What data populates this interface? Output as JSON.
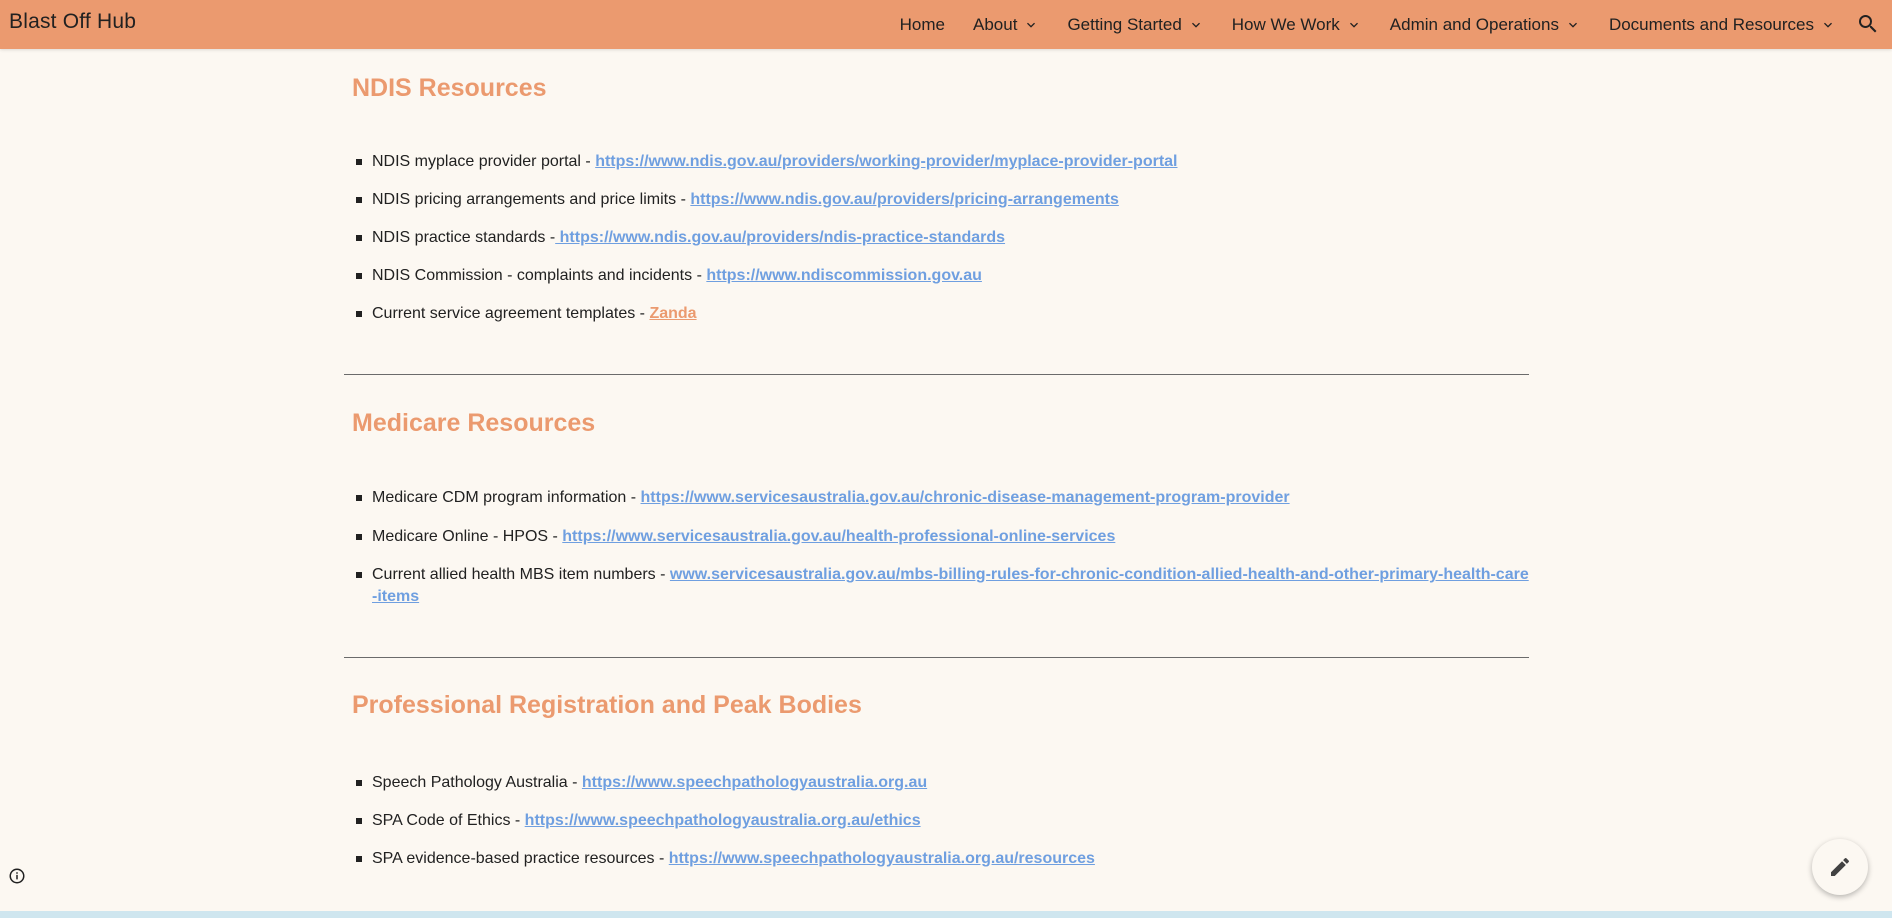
{
  "header": {
    "site_title": "Blast Off Hub",
    "nav": [
      {
        "label": "Home",
        "dropdown": false
      },
      {
        "label": "About",
        "dropdown": true
      },
      {
        "label": "Getting Started",
        "dropdown": true
      },
      {
        "label": "How We Work",
        "dropdown": true
      },
      {
        "label": "Admin and Operations",
        "dropdown": true
      },
      {
        "label": "Documents and Resources",
        "dropdown": true
      }
    ],
    "search_icon": "search-icon"
  },
  "sections": [
    {
      "title": "NDIS Resources",
      "items": [
        {
          "text": "NDIS myplace provider portal - ",
          "link": "https://www.ndis.gov.au/providers/working-provider/myplace-provider-portal"
        },
        {
          "text": "NDIS pricing arrangements and price limits - ",
          "link": "https://www.ndis.gov.au/providers/pricing-arrangements"
        },
        {
          "text": "NDIS practice standards -",
          "link": " https://www.ndis.gov.au/providers/ndis-practice-standards"
        },
        {
          "text": "NDIS Commission - complaints and incidents - ",
          "link": "https://www.ndiscommission.gov.au"
        },
        {
          "text": "Current service agreement templates - ",
          "link": "Zanda "
        }
      ]
    },
    {
      "title": "Medicare Resources",
      "items": [
        {
          "text": "Medicare CDM program information - ",
          "link": "https://www.servicesaustralia.gov.au/chronic-disease-management-program-provider"
        },
        {
          "text": "Medicare Online - HPOS - ",
          "link": "https://www.servicesaustralia.gov.au/health-professional-online-services"
        },
        {
          "text": "Current allied health MBS item numbers - ",
          "link": "www.servicesaustralia.gov.au/mbs-billing-rules-for-chronic-condition-allied-health-and-other-primary-health-care-items"
        }
      ]
    },
    {
      "title": "Professional Registration and Peak Bodies",
      "items": [
        {
          "text": "Speech Pathology Australia - ",
          "link": "https://www.speechpathologyaustralia.org.au"
        },
        {
          "text": "SPA Code of Ethics - ",
          "link": "https://www.speechpathologyaustralia.org.au/ethics"
        },
        {
          "text": "SPA evidence-based practice resources - ",
          "link": "https://www.speechpathologyaustralia.org.au/resources"
        }
      ]
    }
  ],
  "colors": {
    "header_bg": "#eb9a6f",
    "page_bg": "#fcf8f2",
    "heading": "#eb9a6f",
    "link": "#6f9fe0"
  }
}
